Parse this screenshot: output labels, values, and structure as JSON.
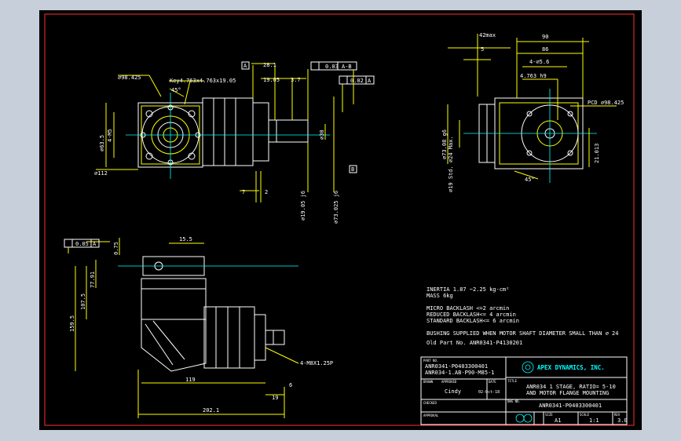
{
  "front_view": {
    "pcd_left": "⌀98.425",
    "key": "Key4.763x4.763x19.05",
    "angle_left": "45°",
    "pilot_dim": "⌀63.5",
    "hole_dim": "4-M5",
    "bolt_dim": "⌀112"
  },
  "side_view": {
    "d1": "28.1",
    "d2": "19.05",
    "d3": "3.7",
    "d4": "7",
    "d5": "2",
    "runout1": "0.03",
    "runout1_ref": "A-B",
    "runout2": "0.02",
    "runout2_ref": "A",
    "shaft_d1": "⌀19.05 j6",
    "shaft_d2": "⌀73.025 j6",
    "datum_a": "A",
    "datum_b": "B",
    "shaft_d3": "⌀30"
  },
  "right_view": {
    "d1": "42max",
    "d2": "5",
    "d3": "90",
    "d4": "86",
    "holes": "4-⌀5.6",
    "key_h": "4.763 h9",
    "pcd": "PCD ⌀98.425",
    "d_left": "⌀73.08 g6",
    "d_small": "⌀19 Std. ⌀24 Max.",
    "angle": "45°",
    "height": "21.013"
  },
  "bottom_view": {
    "flatness": "0.05",
    "flatness_ref": "A",
    "d1": "15.5",
    "d2": "0.75",
    "d3": "77.91",
    "d4": "107.5",
    "d5": "159.5",
    "d6": "119",
    "d7": "6",
    "d8": "19",
    "d9": "202.1",
    "thread": "4-M8X1.25P"
  },
  "specs": [
    "INERTIA 1.87 ~2.25 kg-cm²",
    "MASS 6kg",
    "MICRO BACKLASH <=2 arcmin",
    "REDUCED BACKLASH<= 4 arcmin",
    "STANDARD BACKLASH<= 6 arcmin",
    "BUSHING SUPPLIED WHEN MOTOR SHAFT DIAMETER SMALL THAN ⌀ 24",
    "Old Part No. ANR0341-P4130201"
  ],
  "title_block": {
    "part_no_label": "PART NO.",
    "part_no_1": "ANR0341-P0403300401",
    "part_no_2": "ANR034-1.AB-P90-M85-1",
    "company": "APEX DYNAMICS, INC.",
    "title_label": "TITLE",
    "title_1": "ANR034 1 STAGE, RATIO= 5-10",
    "title_2": "AND MOTOR FLANGE MOUNTING",
    "drawn_label": "DRAWN",
    "approved_label": "APPROVED",
    "date_label": "DATE",
    "drawn_by": "Cindy",
    "date": "02-Oct-18",
    "checked_label": "CHECKED",
    "dwg_label": "DWG NO.",
    "dwg_no": "ANR0341-P0403300401",
    "approval_label": "APPROVAL",
    "size_label": "SIZE",
    "size": "A1",
    "scale_label": "SCALE",
    "scale": "1:1",
    "rev_label": "REV",
    "rev": "3.0"
  }
}
